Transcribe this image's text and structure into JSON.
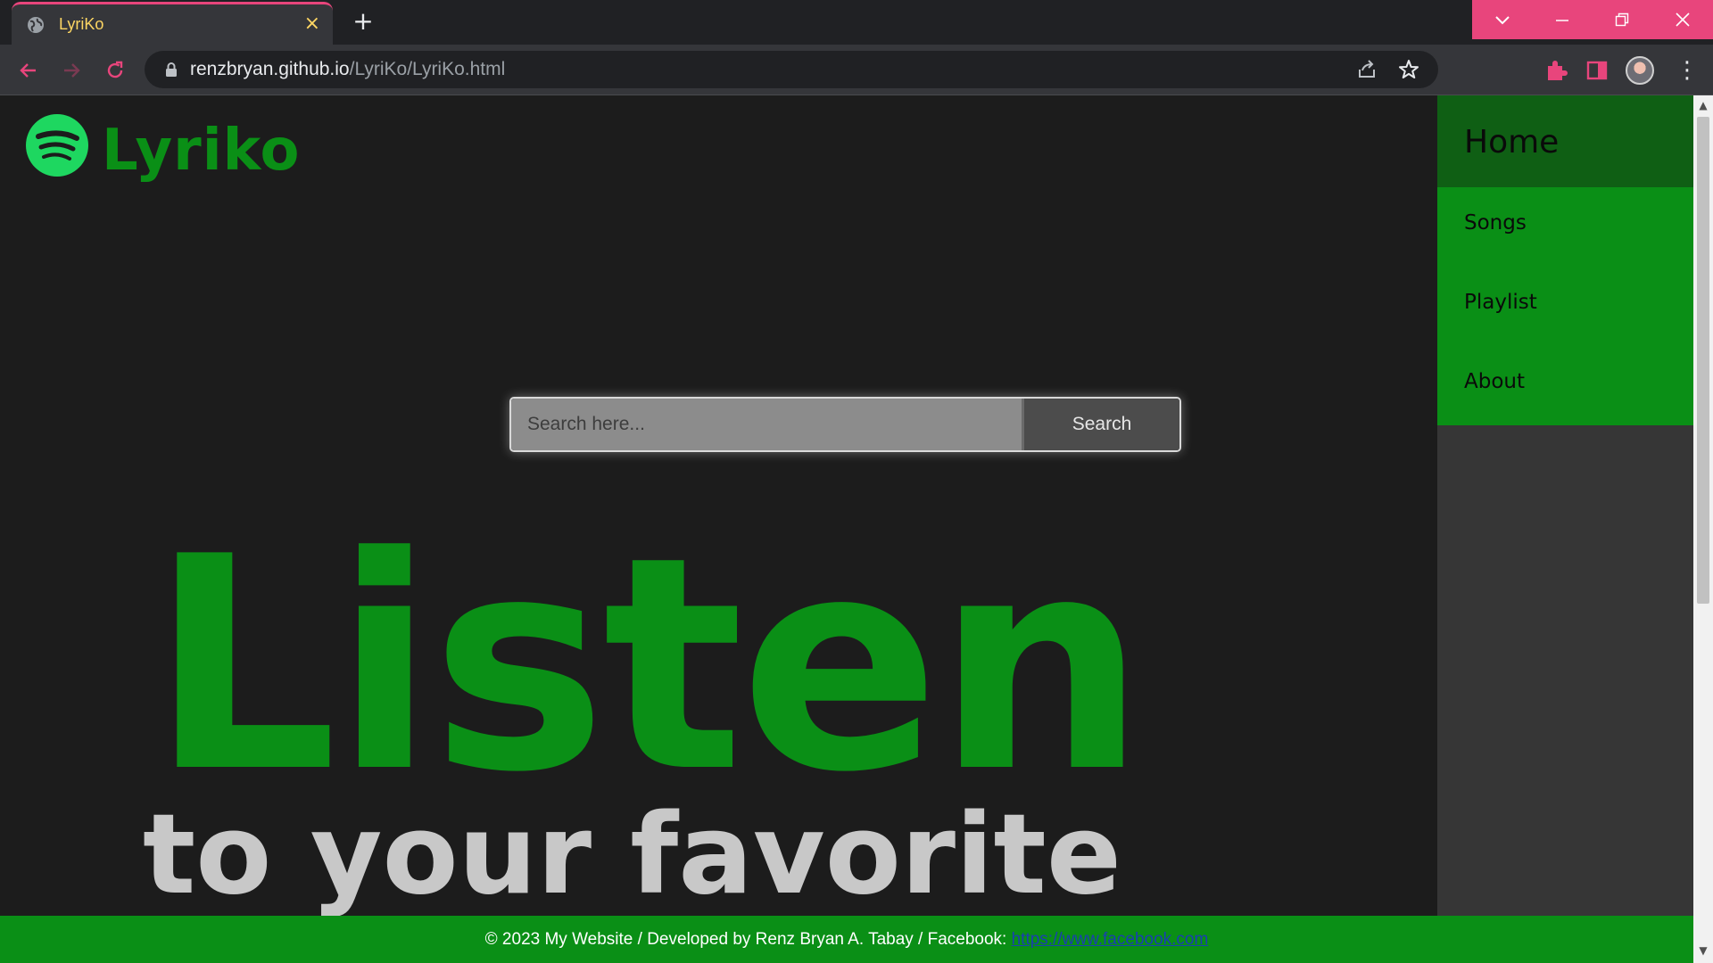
{
  "browser": {
    "tab_title": "LyriKo",
    "tab_close": "×",
    "new_tab": "+",
    "url_host": "renzbryan.github.io",
    "url_path": "/LyriKo/LyriKo.html",
    "window_controls": [
      "chevron-down",
      "minimize",
      "restore",
      "close"
    ],
    "accent_color": "#e8457c"
  },
  "page": {
    "brand_name": "Lyriko",
    "search": {
      "placeholder": "Search here...",
      "button_label": "Search"
    },
    "hero": {
      "headline": "Listen",
      "subline": "to your favorite"
    },
    "sidebar": {
      "items": [
        {
          "label": "Home"
        },
        {
          "label": "Songs"
        },
        {
          "label": "Playlist"
        },
        {
          "label": "About"
        }
      ]
    },
    "footer": {
      "text": "© 2023 My Website / Developed by Renz Bryan A. Tabay / Facebook: ",
      "link_text": "https://www.facebook.com"
    },
    "colors": {
      "brand_green": "#0a8f16",
      "dark_green": "#0f5f14",
      "background": "#1c1c1c"
    }
  }
}
